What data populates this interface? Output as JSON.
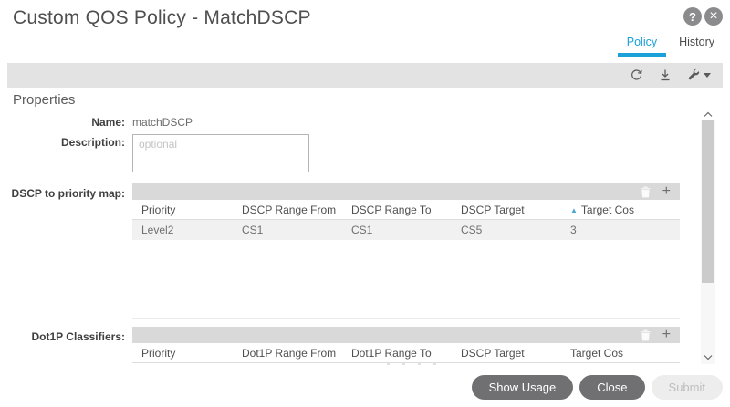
{
  "header": {
    "title": "Custom QOS Policy - MatchDSCP",
    "tabs": [
      {
        "label": "Policy",
        "active": true
      },
      {
        "label": "History",
        "active": false
      }
    ]
  },
  "properties": {
    "section_title": "Properties",
    "name_label": "Name:",
    "name_value": "matchDSCP",
    "description_label": "Description:",
    "description_placeholder": "optional",
    "description_value": ""
  },
  "dscp_table": {
    "label": "DSCP to priority map:",
    "columns": [
      "Priority",
      "DSCP Range From",
      "DSCP Range To",
      "DSCP Target",
      "Target Cos"
    ],
    "sort_column": "Target Cos",
    "sort_direction": "asc",
    "rows": [
      [
        "Level2",
        "CS1",
        "CS1",
        "CS5",
        "3"
      ]
    ]
  },
  "dot1p_table": {
    "label": "Dot1P Classifiers:",
    "columns": [
      "Priority",
      "Dot1P Range From",
      "Dot1P Range To",
      "DSCP Target",
      "Target Cos"
    ],
    "rows": []
  },
  "footer": {
    "buttons": [
      {
        "label": "Show Usage",
        "enabled": true
      },
      {
        "label": "Close",
        "enabled": true
      },
      {
        "label": "Submit",
        "enabled": false
      }
    ]
  },
  "icons": {
    "help_glyph": "?",
    "close_glyph": "×",
    "plus_glyph": "+",
    "sort_asc_glyph": "▲"
  },
  "colors": {
    "accent_blue": "#1ba0d7",
    "toolbar_gray": "#e3e3e3",
    "table_toolbar_gray": "#d9d9d9",
    "row_stripe": "#f1f1f1",
    "button_dark": "#707072",
    "button_disabled_bg": "#ededed",
    "icon_circle_gray": "#8b8b8d"
  }
}
